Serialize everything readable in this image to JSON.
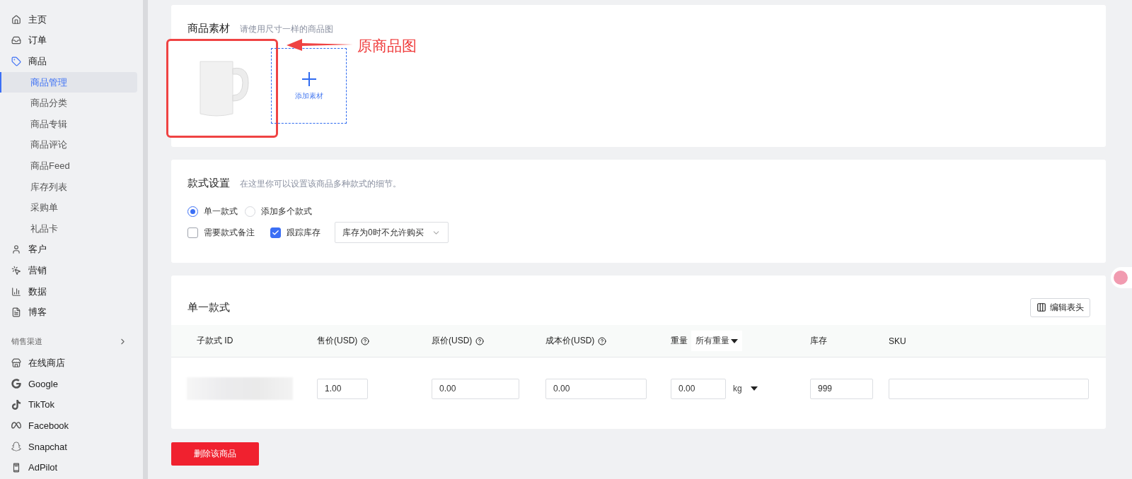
{
  "sidebar": {
    "items": [
      {
        "label": "主页",
        "selected": false
      },
      {
        "label": "订单",
        "selected": false
      },
      {
        "label": "商品",
        "selected": false,
        "children": [
          {
            "label": "商品管理",
            "selected": true
          },
          {
            "label": "商品分类",
            "selected": false
          },
          {
            "label": "商品专辑",
            "selected": false
          },
          {
            "label": "商品评论",
            "selected": false
          },
          {
            "label": "商品Feed",
            "selected": false
          },
          {
            "label": "库存列表",
            "selected": false
          },
          {
            "label": "采购单",
            "selected": false
          },
          {
            "label": "礼品卡",
            "selected": false
          }
        ]
      },
      {
        "label": "客户",
        "selected": false
      },
      {
        "label": "营销",
        "selected": false
      },
      {
        "label": "数据",
        "selected": false
      },
      {
        "label": "博客",
        "selected": false
      }
    ],
    "section": "销售渠道",
    "channels": [
      "在线商店",
      "Google",
      "TikTok",
      "Facebook",
      "Snapchat",
      "AdPilot"
    ]
  },
  "media": {
    "title": "商品素材",
    "hint": "请使用尺寸一样的商品图",
    "add_label": "添加素材",
    "annotation": "原商品图"
  },
  "variant_settings": {
    "title": "款式设置",
    "hint": "在这里你可以设置该商品多种款式的细节。",
    "options": [
      {
        "label": "单一款式",
        "selected": true
      },
      {
        "label": "添加多个款式",
        "selected": false
      }
    ],
    "checkboxes": [
      {
        "label": "需要款式备注",
        "checked": false
      },
      {
        "label": "跟踪库存",
        "checked": true
      }
    ],
    "stock_policy": "库存为0时不允许购买"
  },
  "variant_table": {
    "title": "单一款式",
    "edit_button": "编辑表头",
    "columns": [
      {
        "label": "子款式 ID",
        "help": false
      },
      {
        "label": "售价(USD)",
        "help": true
      },
      {
        "label": "原价(USD)",
        "help": true
      },
      {
        "label": "成本价(USD)",
        "help": true
      },
      {
        "label": "重量",
        "help": false,
        "filter": "所有重量"
      },
      {
        "label": "库存",
        "help": false
      },
      {
        "label": "SKU",
        "help": false
      }
    ],
    "row": {
      "price": "1.00",
      "compare_price": "0.00",
      "cost": "0.00",
      "weight": "0.00",
      "unit": "kg",
      "stock": "999"
    }
  },
  "delete_button": "删除该商品"
}
